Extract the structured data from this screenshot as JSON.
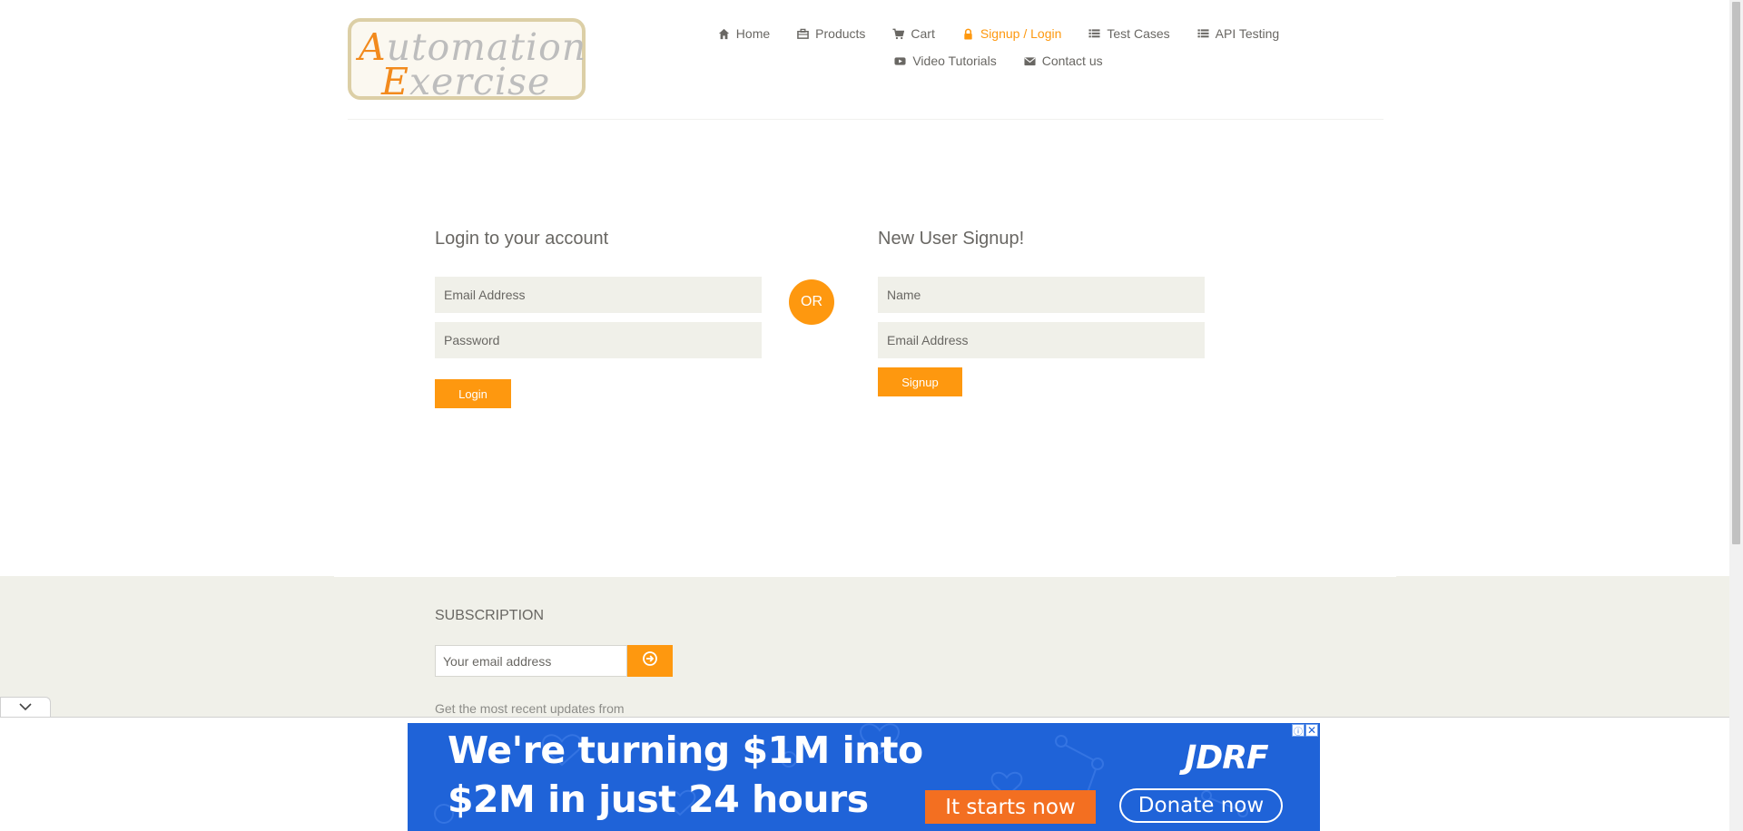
{
  "header": {
    "logo": {
      "line1_cap": "A",
      "line1_rest": "utomation",
      "line2_cap": "E",
      "line2_rest": "xercise"
    },
    "nav": [
      {
        "label": "Home",
        "icon": "home-icon"
      },
      {
        "label": "Products",
        "icon": "products-icon"
      },
      {
        "label": "Cart",
        "icon": "cart-icon"
      },
      {
        "label": "Signup / Login",
        "icon": "lock-icon",
        "active": true
      },
      {
        "label": "Test Cases",
        "icon": "list-icon"
      },
      {
        "label": "API Testing",
        "icon": "list-icon"
      },
      {
        "label": "Video Tutorials",
        "icon": "youtube-icon"
      },
      {
        "label": "Contact us",
        "icon": "envelope-icon"
      }
    ]
  },
  "login": {
    "title": "Login to your account",
    "email_placeholder": "Email Address",
    "password_placeholder": "Password",
    "button": "Login"
  },
  "divider": {
    "label": "OR"
  },
  "signup": {
    "title": "New User Signup!",
    "name_placeholder": "Name",
    "email_placeholder": "Email Address",
    "button": "Signup"
  },
  "footer": {
    "subscription_title": "SUBSCRIPTION",
    "email_placeholder": "Your email address",
    "note": "Get the most recent updates from"
  },
  "ad": {
    "line1": "We're turning $1M into",
    "line2": "$2M in just 24 hours",
    "brand": "JDRF",
    "cta_primary": "It starts now",
    "cta_secondary": "Donate now",
    "info_glyph": "ⓘ",
    "close_glyph": "✕"
  },
  "colors": {
    "accent": "#fe980f",
    "text": "#696763",
    "field_bg": "#f0f0e9",
    "ad_bg": "#1f63d8"
  }
}
